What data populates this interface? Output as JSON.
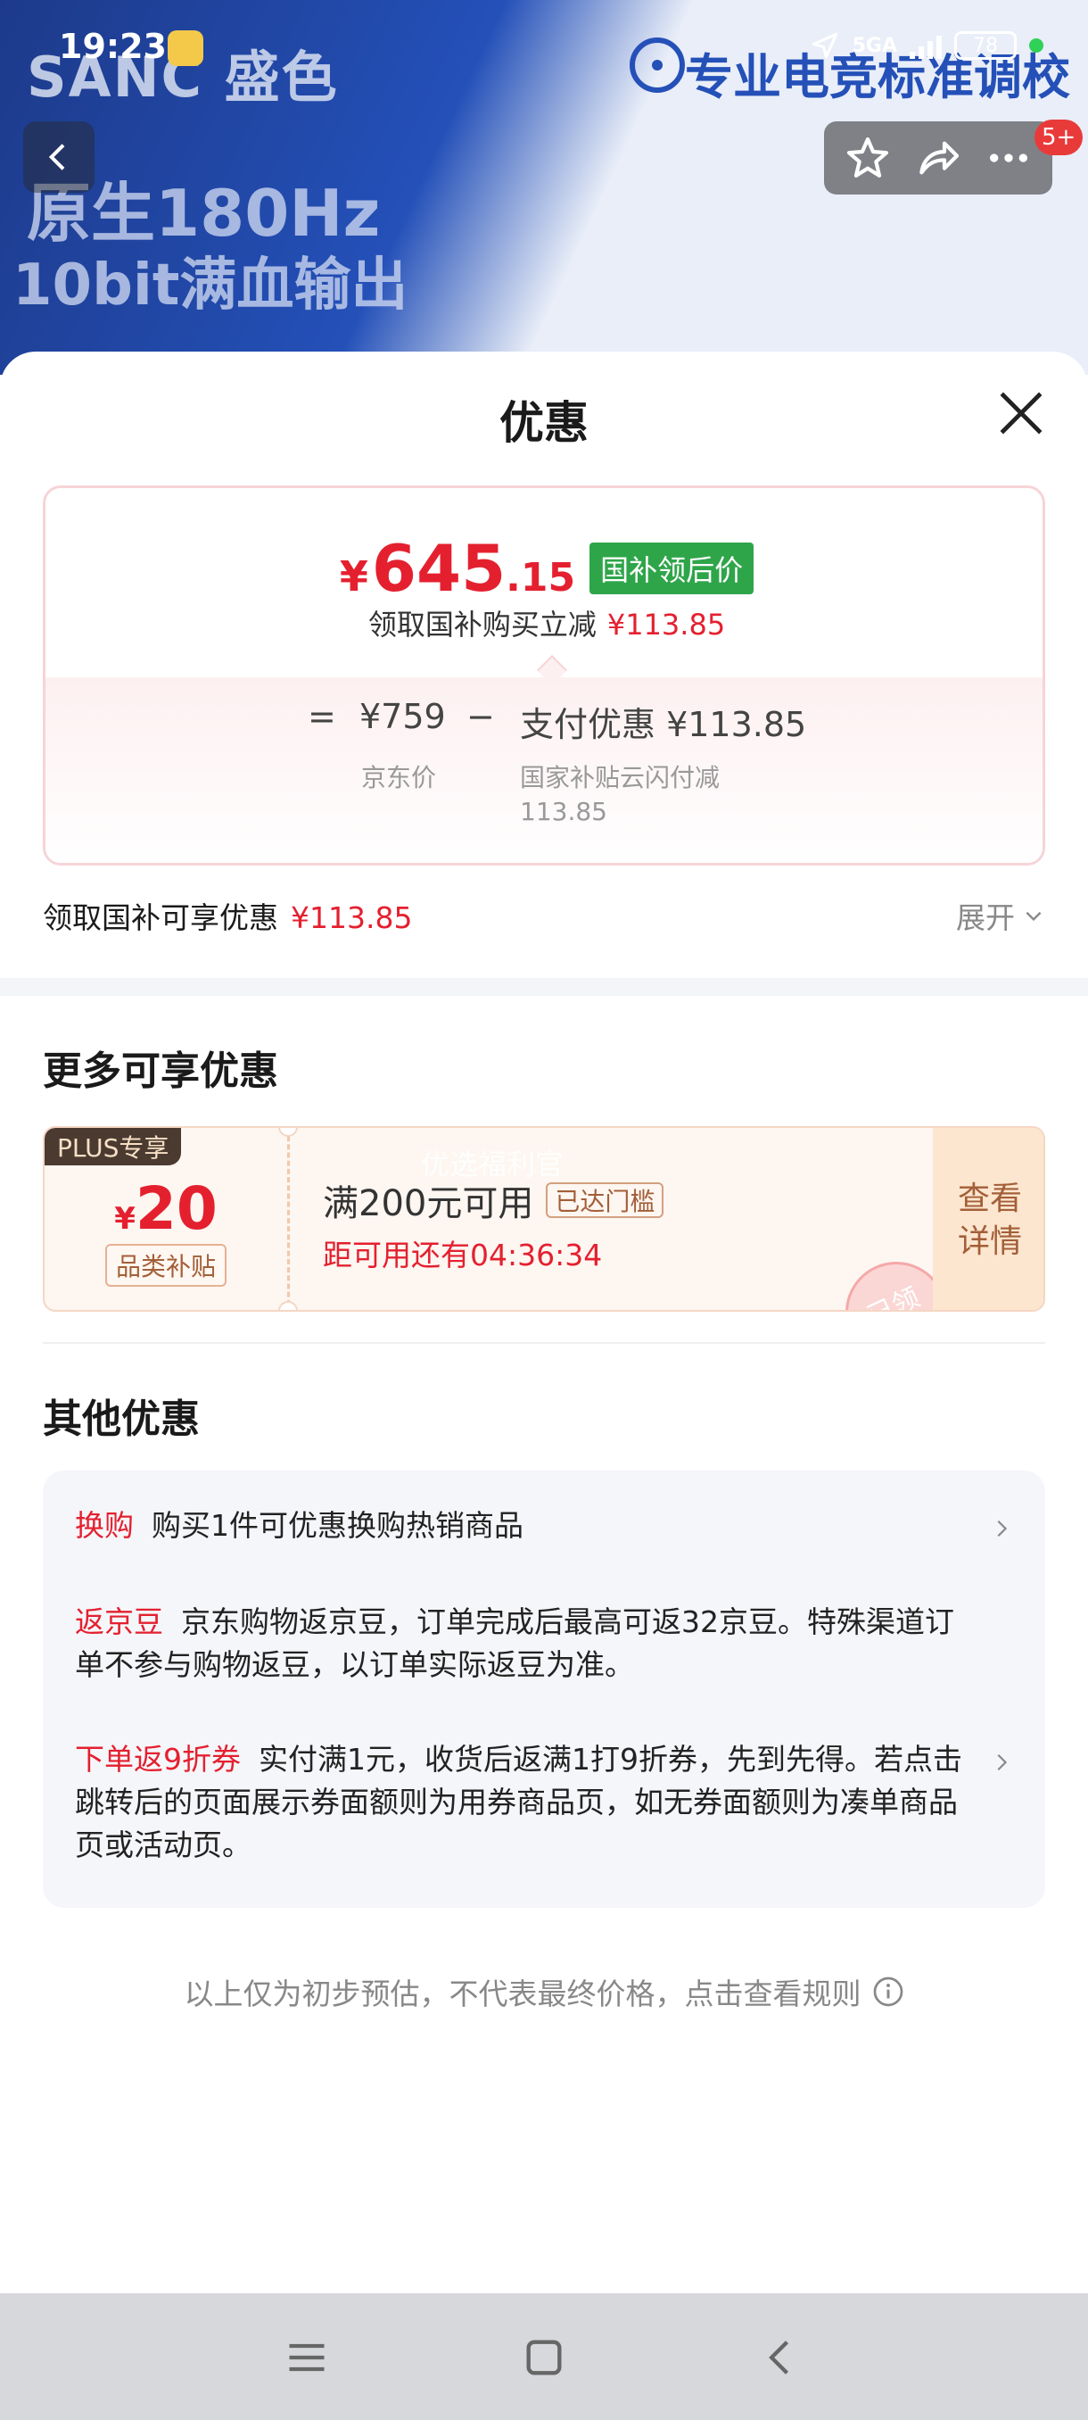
{
  "status_bar": {
    "time": "19:23",
    "network": "5GA",
    "battery": "78"
  },
  "background": {
    "brand": "SANC 盛色",
    "slogan_right": "专业电竞标准调校",
    "line1": "原生180Hz",
    "line2": "10bit满血输出"
  },
  "header_actions": {
    "badge": "5+"
  },
  "sheet": {
    "title": "优惠",
    "price": {
      "yen": "¥",
      "integer": "645",
      "decimal": ".15",
      "tag": "国补领后价",
      "sub_label": "领取国补购买立减",
      "sub_amount": "¥113.85"
    },
    "equation": {
      "equals": "=",
      "jd_price": "¥759",
      "minus": "−",
      "pay_discount": "支付优惠 ¥113.85",
      "jd_note": "京东价",
      "pay_note": "国家补贴云闪付减 113.85"
    },
    "subsidy_row": {
      "label": "领取国补可享优惠",
      "amount": "¥113.85",
      "expand": "展开"
    },
    "more_title": "更多可享优惠",
    "coupon": {
      "plus_tag": "PLUS专享",
      "yen": "¥",
      "amount": "20",
      "category": "品类补贴",
      "watermark": "优选福利官",
      "condition": "满200元可用",
      "threshold": "已达门槛",
      "timer": "距可用还有04:36:34",
      "stamp": "已领",
      "button": "查看详情"
    },
    "other_title": "其他优惠",
    "other_items": [
      {
        "tag": "换购",
        "text": "购买1件可优惠换购热销商品"
      },
      {
        "tag": "返京豆",
        "text": "京东购物返京豆，订单完成后最高可返32京豆。特殊渠道订单不参与购物返豆，以订单实际返豆为准。"
      },
      {
        "tag": "下单返9折券",
        "text": "实付满1元，收货后返满1打9折券，先到先得。若点击跳转后的页面展示券面额则为用券商品页，如无券面额则为凑单商品页或活动页。"
      }
    ],
    "footer": "以上仅为初步预估，不代表最终价格，点击查看规则"
  },
  "colors": {
    "accent_red": "#e4202f",
    "tag_green": "#2fa54a",
    "coupon_brown": "#a35f38"
  },
  "icons": [
    "back-icon",
    "star-icon",
    "share-icon",
    "more-icon",
    "close-icon",
    "chevron-down-icon",
    "chevron-right-icon",
    "info-icon",
    "menu-icon",
    "home-icon",
    "nav-back-icon"
  ]
}
